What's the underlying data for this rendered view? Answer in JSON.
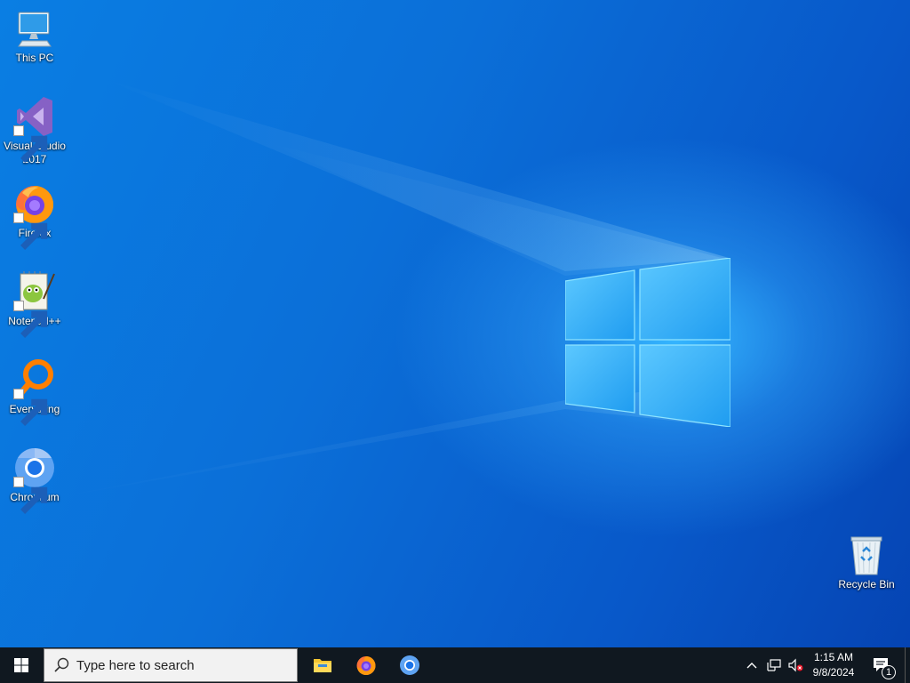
{
  "desktop": {
    "icons": [
      {
        "label": "This PC",
        "icon": "this-pc-icon"
      },
      {
        "label": "Visual Studio\n2017",
        "icon": "visual-studio-icon"
      },
      {
        "label": "Firefox",
        "icon": "firefox-icon"
      },
      {
        "label": "Notepad++",
        "icon": "notepad-plus-plus-icon"
      },
      {
        "label": "Everything",
        "icon": "everything-icon"
      },
      {
        "label": "Chromium",
        "icon": "chromium-icon"
      },
      {
        "label": "Recycle Bin",
        "icon": "recycle-bin-icon"
      }
    ]
  },
  "taskbar": {
    "start_icon": "windows-start-icon",
    "search": {
      "placeholder": "Type here to search",
      "value": ""
    },
    "pinned": [
      {
        "name": "File Explorer",
        "icon": "file-explorer-icon"
      },
      {
        "name": "Firefox",
        "icon": "firefox-icon"
      },
      {
        "name": "Chromium",
        "icon": "chromium-icon"
      }
    ],
    "tray": {
      "time": "1:15 AM",
      "date": "9/8/2024",
      "notification_count": "1"
    }
  },
  "colors": {
    "taskbar": "#101820",
    "desktop_accent": "#0a7ee3",
    "logo": "#7fd6ff"
  }
}
